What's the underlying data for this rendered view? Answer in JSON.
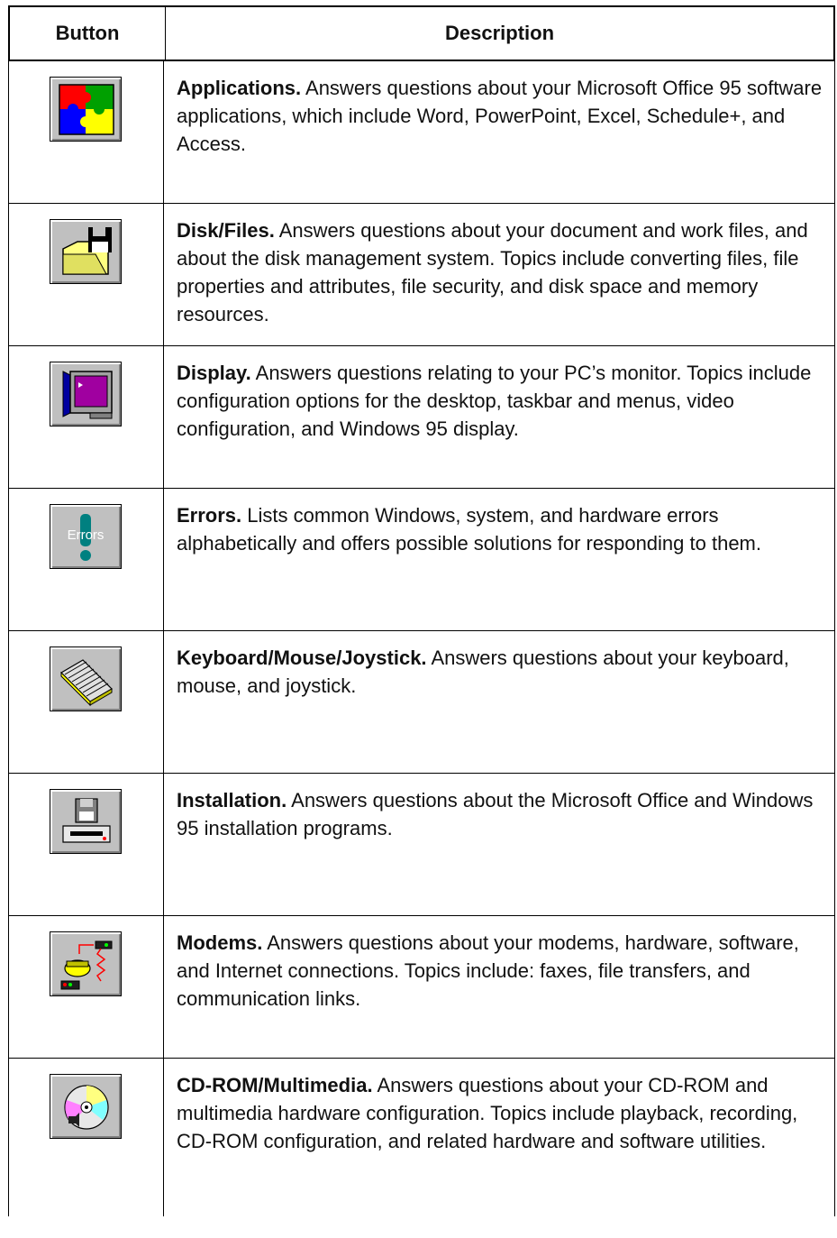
{
  "header": {
    "col_button": "Button",
    "col_description": "Description"
  },
  "rows": [
    {
      "icon": "puzzle-icon",
      "title": "Applications.",
      "text": " Answers questions about your Microsoft Office 95 software applications, which include Word, PowerPoint, Excel, Schedule+, and Access."
    },
    {
      "icon": "disk-files-icon",
      "title": "Disk/Files.",
      "text": " Answers questions about your document and work files, and about the disk management system. Topics include converting files, file properties and attributes, file security, and disk space and memory resources."
    },
    {
      "icon": "monitor-icon",
      "title": "Display.",
      "text": " Answers questions relating to your PC’s monitor. Topics include configuration options for the desktop, taskbar and menus, video configuration, and Windows 95 display."
    },
    {
      "icon": "errors-icon",
      "title": "Errors.",
      "text": " Lists common Windows, system, and hardware errors alphabetically and offers possible solutions for responding to them.",
      "icon_label": "Errors"
    },
    {
      "icon": "keyboard-icon",
      "title": "Keyboard/Mouse/Joystick.",
      "text": " Answers questions about your keyboard, mouse, and joystick."
    },
    {
      "icon": "installation-icon",
      "title": "Installation.",
      "text": " Answers questions about the Microsoft Office and Windows 95 installation programs."
    },
    {
      "icon": "modem-icon",
      "title": "Modems.",
      "text": " Answers questions about your modems, hardware, software, and Internet connections. Topics include: faxes, file transfers, and communication links."
    },
    {
      "icon": "cdrom-icon",
      "title": "CD-ROM/Multimedia.",
      "text": " Answers questions about your CD-ROM and multimedia hardware configuration. Topics include playback, recording, CD-ROM configuration, and related hardware and software utilities."
    }
  ]
}
